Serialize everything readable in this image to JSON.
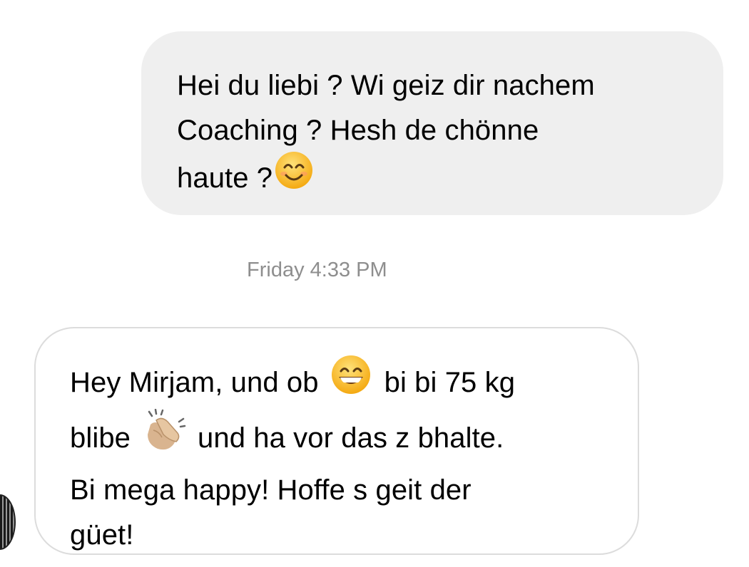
{
  "conversation": {
    "outgoing_message": {
      "lines": [
        "Hei du liebi ? Wi geiz dir nachem",
        "Coaching ? Hesh de chönne",
        "haute ?"
      ],
      "emoji": "smiling-face-with-smiling-eyes"
    },
    "timestamp": "Friday 4:33 PM",
    "incoming_message": {
      "line1_a": "Hey Mirjam, und ob",
      "line1_emoji": "grinning-face-with-smiling-eyes",
      "line1_b": "bi bi 75 kg",
      "line2_a": "blibe",
      "line2_emoji": "clapping-hands",
      "line2_b": "und ha vor das z bhalte.",
      "line3": "Bi mega happy! Hoffe s geit der",
      "line4": "güet!"
    },
    "avatar": "user-avatar"
  },
  "colors": {
    "outgoing_bubble": "#efefef",
    "incoming_border": "#dcdcdc",
    "timestamp": "#8e8e8e",
    "emoji_face": "#f9c531"
  }
}
